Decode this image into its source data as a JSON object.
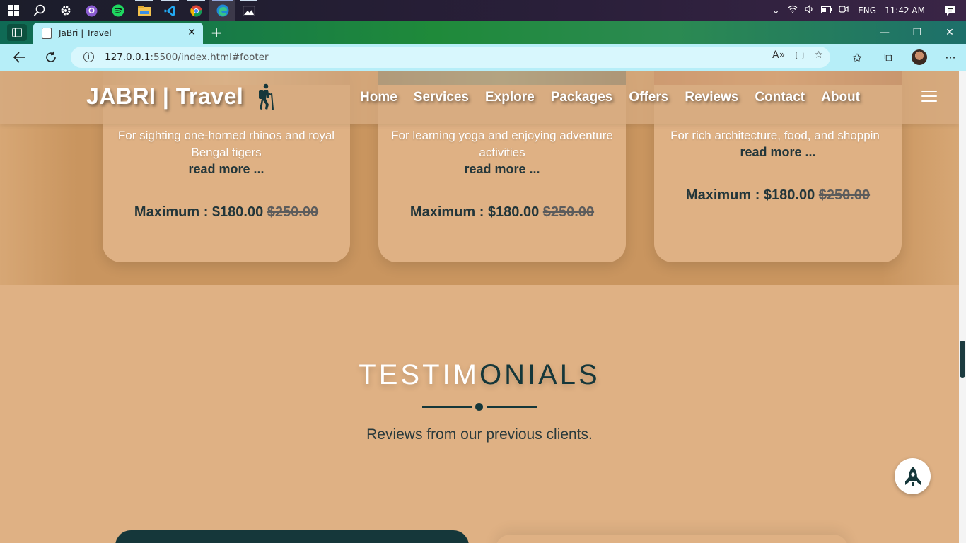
{
  "taskbar": {
    "apps": [
      {
        "name": "start",
        "glyph": "⊞"
      },
      {
        "name": "search",
        "glyph": "⚲"
      },
      {
        "name": "settings",
        "glyph": "⚙"
      },
      {
        "name": "github",
        "glyph": "●"
      },
      {
        "name": "spotify",
        "glyph": "●"
      },
      {
        "name": "file-explorer",
        "glyph": "▇"
      },
      {
        "name": "vscode",
        "glyph": "❰❱"
      },
      {
        "name": "chrome",
        "glyph": "◉"
      },
      {
        "name": "edge",
        "glyph": "◐"
      },
      {
        "name": "photos",
        "glyph": "▣"
      }
    ],
    "language": "ENG",
    "time": "11:42 AM"
  },
  "browser": {
    "tab_title": "JaBri | Travel",
    "url_host": "127.0.0.1",
    "url_rest": ":5500/index.html#footer"
  },
  "site": {
    "logo": "JABRI | Travel",
    "nav": [
      "Home",
      "Services",
      "Explore",
      "Packages",
      "Offers",
      "Reviews",
      "Contact",
      "About"
    ]
  },
  "packages": [
    {
      "desc": "For sighting one-horned rhinos and royal Bengal tigers",
      "more": "read more ...",
      "price_label": "Maximum : $180.00",
      "old_price": "$250.00"
    },
    {
      "desc": "For learning yoga and enjoying adventure activities",
      "more": "read more ...",
      "price_label": "Maximum : $180.00",
      "old_price": "$250.00"
    },
    {
      "desc": "For rich architecture, food, and shoppin",
      "more": "read more ...",
      "price_label": "Maximum : $180.00",
      "old_price": "$250.00"
    }
  ],
  "testimonials": {
    "title_white": "TESTIM",
    "title_dark": "ONIALS",
    "subtitle": "Reviews from our previous clients."
  },
  "colors": {
    "page_bg": "#dfb184",
    "dark_teal": "#15373a",
    "tab_bg": "#b6eef8"
  }
}
